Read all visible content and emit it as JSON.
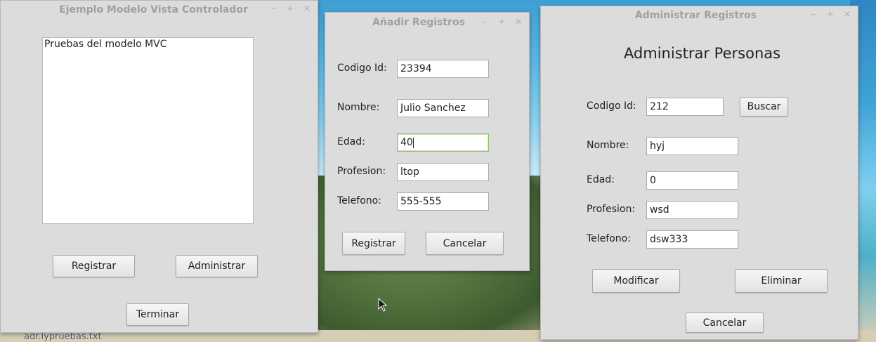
{
  "desktop": {
    "file_label": "adr.lypruebas.txt"
  },
  "main_window": {
    "title": "Ejemplo Modelo Vista Controlador",
    "text_area": "Pruebas del modelo MVC",
    "buttons": {
      "registrar": "Registrar",
      "administrar": "Administrar",
      "terminar": "Terminar"
    }
  },
  "add_window": {
    "title": "Añadir Registros",
    "fields": [
      {
        "label": "Codigo Id:",
        "value": "23394"
      },
      {
        "label": "Nombre:",
        "value": "Julio Sanchez"
      },
      {
        "label": "Edad:",
        "value": "40"
      },
      {
        "label": "Profesion:",
        "value": "ltop"
      },
      {
        "label": "Telefono:",
        "value": "555-555"
      }
    ],
    "buttons": {
      "registrar": "Registrar",
      "cancelar": "Cancelar"
    }
  },
  "admin_window": {
    "title": "Administrar Registros",
    "heading": "Administrar Personas",
    "fields": [
      {
        "label": "Codigo Id:",
        "value": "212"
      },
      {
        "label": "Nombre:",
        "value": "hyj"
      },
      {
        "label": "Edad:",
        "value": "0"
      },
      {
        "label": "Profesion:",
        "value": "wsd"
      },
      {
        "label": "Telefono:",
        "value": "dsw333"
      }
    ],
    "buttons": {
      "buscar": "Buscar",
      "modificar": "Modificar",
      "eliminar": "Eliminar",
      "cancelar": "Cancelar"
    }
  },
  "window_controls": {
    "minimize": "–",
    "maximize": "+",
    "close": "×"
  }
}
